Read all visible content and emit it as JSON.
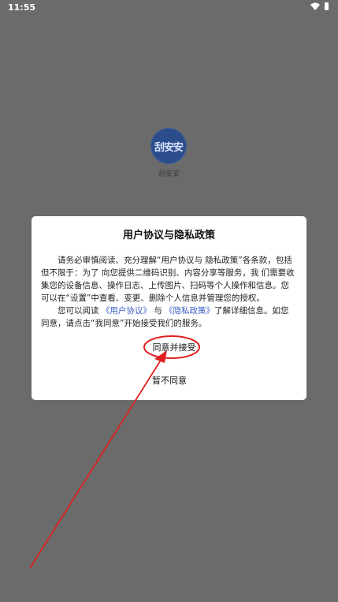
{
  "status_bar": {
    "time": "11:55",
    "wifi_icon": "wifi-icon",
    "battery_icon": "battery-icon"
  },
  "app": {
    "logo_text": "刮安安",
    "name": "刮安安"
  },
  "dialog": {
    "title": "用户协议与隐私政策",
    "paragraph1": "请务必审慎阅读、充分理解“用户协议与 隐私政策”各条款，包括但不限于：为了 向您提供二维码识别、内容分享等服务，我 们需要收集您的设备信息、操作日志、上传图片、扫码等个人操作和信息。您可以在“设置”中查看、变更、删除个人信息并管理您的授权。",
    "p2_prefix": "您可以阅读",
    "p2_link_agreement": "《用户协议》",
    "p2_and": "与",
    "p2_link_privacy": "《隐私政策》",
    "p2_suffix": "了解详细信息。如您同意，请点击“我同意”开始接受我们的服务。",
    "accept_label": "同意并接受",
    "decline_label": "暂不同意"
  },
  "colors": {
    "backdrop": "#6b6b6b",
    "dialog_bg": "#ffffff",
    "link": "#3b5cc4",
    "annotation": "#e02020",
    "logo_bg": "#2b4d8b"
  }
}
